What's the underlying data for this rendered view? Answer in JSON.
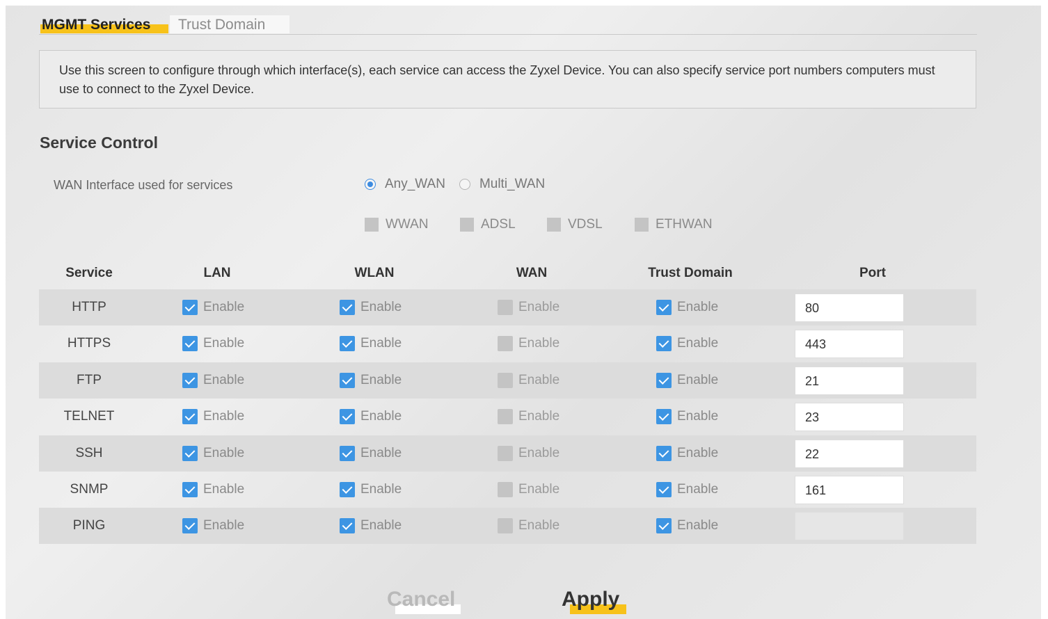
{
  "tabs": [
    {
      "label": "MGMT Services",
      "active": true
    },
    {
      "label": "Trust Domain",
      "active": false
    }
  ],
  "description": "Use this screen to configure through which interface(s), each service can access the Zyxel Device. You can also specify service port numbers computers must use to connect to the Zyxel Device.",
  "section_title": "Service Control",
  "wan_interface": {
    "label": "WAN Interface used for services",
    "options": [
      {
        "label": "Any_WAN",
        "selected": true
      },
      {
        "label": "Multi_WAN",
        "selected": false
      }
    ],
    "types": [
      "WWAN",
      "ADSL",
      "VDSL",
      "ETHWAN"
    ]
  },
  "table": {
    "headers": [
      "Service",
      "LAN",
      "WLAN",
      "WAN",
      "Trust Domain",
      "Port"
    ],
    "enable_label": "Enable",
    "rows": [
      {
        "service": "HTTP",
        "lan": true,
        "wlan": true,
        "wan": false,
        "trust": true,
        "port": "80"
      },
      {
        "service": "HTTPS",
        "lan": true,
        "wlan": true,
        "wan": false,
        "trust": true,
        "port": "443"
      },
      {
        "service": "FTP",
        "lan": true,
        "wlan": true,
        "wan": false,
        "trust": true,
        "port": "21"
      },
      {
        "service": "TELNET",
        "lan": true,
        "wlan": true,
        "wan": false,
        "trust": true,
        "port": "23"
      },
      {
        "service": "SSH",
        "lan": true,
        "wlan": true,
        "wan": false,
        "trust": true,
        "port": "22"
      },
      {
        "service": "SNMP",
        "lan": true,
        "wlan": true,
        "wan": false,
        "trust": true,
        "port": "161"
      },
      {
        "service": "PING",
        "lan": true,
        "wlan": true,
        "wan": false,
        "trust": true,
        "port": ""
      }
    ]
  },
  "buttons": {
    "cancel": "Cancel",
    "apply": "Apply"
  },
  "colors": {
    "accent": "#f7c21a",
    "checkbox": "#3d95e3",
    "disabled": "#c4c4c4"
  }
}
